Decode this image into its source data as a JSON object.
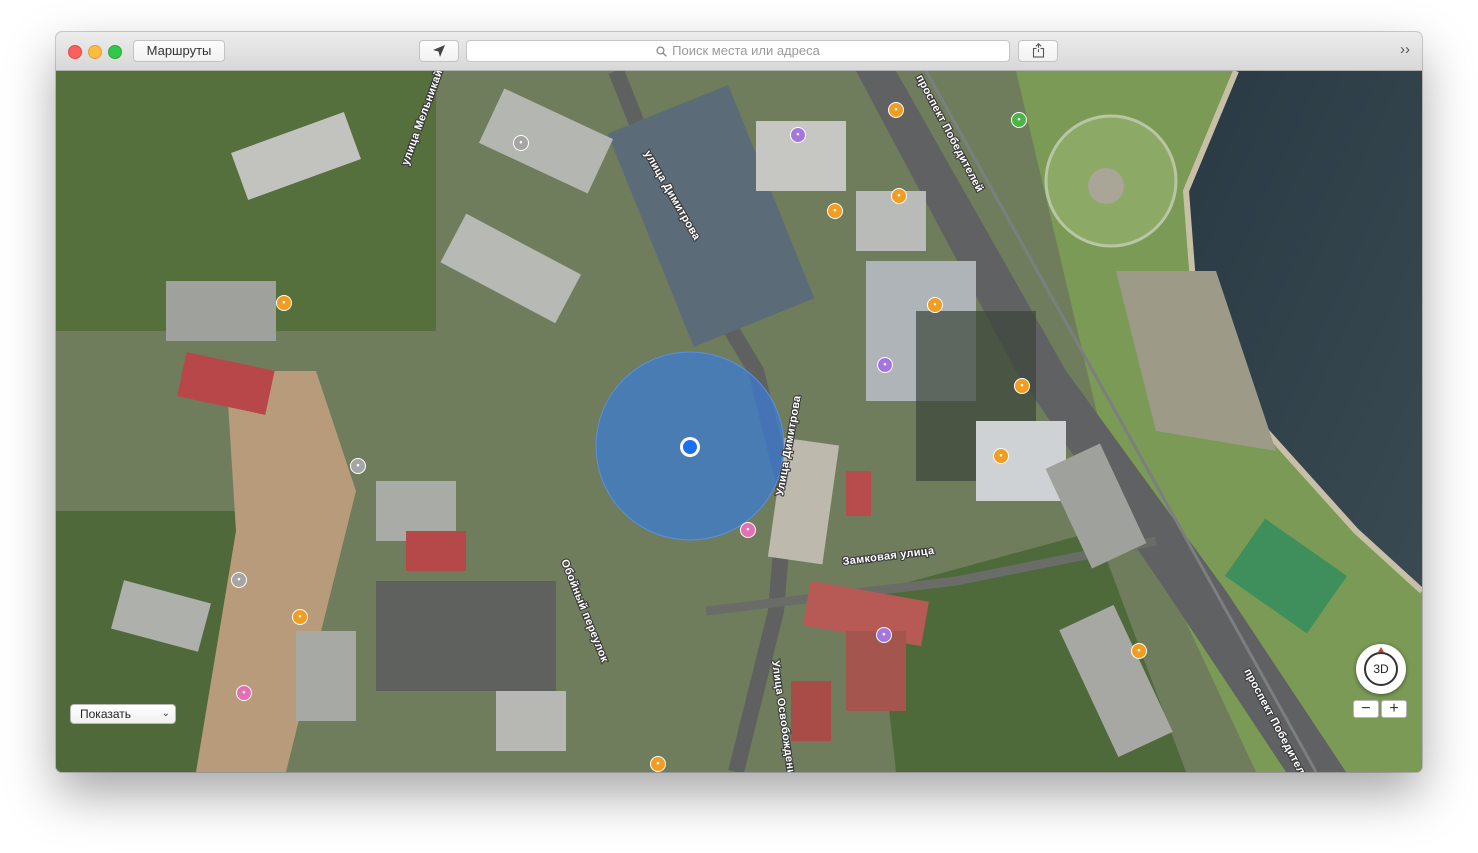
{
  "toolbar": {
    "routes_label": "Маршруты",
    "search_placeholder": "Поиск места или адреса",
    "locate_icon": "location-arrow-icon",
    "share_icon": "share-icon",
    "overflow_icon": "chevrons-right-icon",
    "overflow_glyph": "››"
  },
  "map": {
    "view": "satellite",
    "streets": [
      "улица Мельникайте",
      "проспект Победителей",
      "улица Димитрова",
      "Улица Димитрова",
      "Замковая улица",
      "Обойный переулок",
      "Улица Освобождения",
      "проспект Победителей"
    ],
    "accent": "#3a7bd5",
    "location_dot": "#1c6ff0"
  },
  "controls": {
    "show_label": "Показать",
    "compass_label": "3D",
    "zoom_out": "−",
    "zoom_in": "+"
  }
}
